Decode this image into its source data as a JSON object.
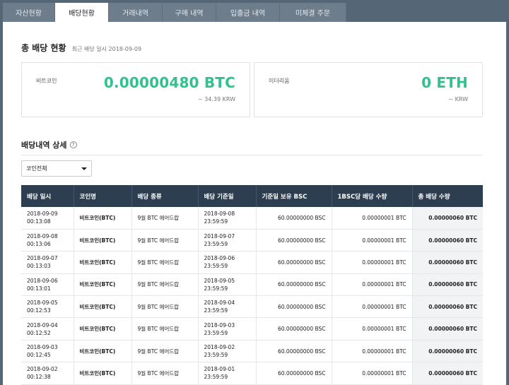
{
  "tabs": [
    {
      "label": "자산현황",
      "active": false
    },
    {
      "label": "배당현황",
      "active": true
    },
    {
      "label": "거래내역",
      "active": false
    },
    {
      "label": "구매 내역",
      "active": false
    },
    {
      "label": "입출금 내역",
      "active": false
    },
    {
      "label": "미체결 주문",
      "active": false
    }
  ],
  "summary": {
    "title": "총 배당 현황",
    "recent": "최근 배당 일시 2018-09-09",
    "btc": {
      "label": "비트코인",
      "amount": "0.00000480 BTC",
      "krw": "~ 34.39 KRW"
    },
    "eth": {
      "label": "이더리움",
      "amount": "0 ETH",
      "krw": "~ KRW"
    }
  },
  "detail": {
    "title": "배당내역 상세",
    "help": "?",
    "filter": {
      "selected": "코인전체"
    }
  },
  "table": {
    "headers": [
      "배당 일시",
      "코인명",
      "배당 종류",
      "배당 기준일",
      "기준일 보유 BSC",
      "1BSC당 배당 수량",
      "총 배당 수량"
    ],
    "rows": [
      {
        "date": "2018-09-09",
        "time": "00:13:08",
        "coin": "비트코인(BTC)",
        "type": "9월 BTC 에어드랍",
        "base_date": "2018-09-08",
        "base_time": "23:59:59",
        "holding": "60.00000000 BSC",
        "per": "0.00000001 BTC",
        "total": "0.00000060 BTC"
      },
      {
        "date": "2018-09-08",
        "time": "00:13:06",
        "coin": "비트코인(BTC)",
        "type": "9월 BTC 에어드랍",
        "base_date": "2018-09-07",
        "base_time": "23:59:59",
        "holding": "60.00000000 BSC",
        "per": "0.00000001 BTC",
        "total": "0.00000060 BTC"
      },
      {
        "date": "2018-09-07",
        "time": "00:13:03",
        "coin": "비트코인(BTC)",
        "type": "9월 BTC 에어드랍",
        "base_date": "2018-09-06",
        "base_time": "23:59:59",
        "holding": "60.00000000 BSC",
        "per": "0.00000001 BTC",
        "total": "0.00000060 BTC"
      },
      {
        "date": "2018-09-06",
        "time": "00:13:01",
        "coin": "비트코인(BTC)",
        "type": "9월 BTC 에어드랍",
        "base_date": "2018-09-05",
        "base_time": "23:59:59",
        "holding": "60.00000000 BSC",
        "per": "0.00000001 BTC",
        "total": "0.00000060 BTC"
      },
      {
        "date": "2018-09-05",
        "time": "00:12:53",
        "coin": "비트코인(BTC)",
        "type": "9월 BTC 에어드랍",
        "base_date": "2018-09-04",
        "base_time": "23:59:59",
        "holding": "60.00000000 BSC",
        "per": "0.00000001 BTC",
        "total": "0.00000060 BTC"
      },
      {
        "date": "2018-09-04",
        "time": "00:12:52",
        "coin": "비트코인(BTC)",
        "type": "9월 BTC 에어드랍",
        "base_date": "2018-09-03",
        "base_time": "23:59:59",
        "holding": "60.00000000 BSC",
        "per": "0.00000001 BTC",
        "total": "0.00000060 BTC"
      },
      {
        "date": "2018-09-03",
        "time": "00:12:45",
        "coin": "비트코인(BTC)",
        "type": "9월 BTC 에어드랍",
        "base_date": "2018-09-02",
        "base_time": "23:59:59",
        "holding": "60.00000000 BSC",
        "per": "0.00000001 BTC",
        "total": "0.00000060 BTC"
      },
      {
        "date": "2018-09-02",
        "time": "00:12:38",
        "coin": "비트코인(BTC)",
        "type": "9월 BTC 에어드랍",
        "base_date": "2018-09-01",
        "base_time": "23:59:59",
        "holding": "60.00000000 BSC",
        "per": "0.00000001 BTC",
        "total": "0.00000060 BTC"
      }
    ]
  }
}
